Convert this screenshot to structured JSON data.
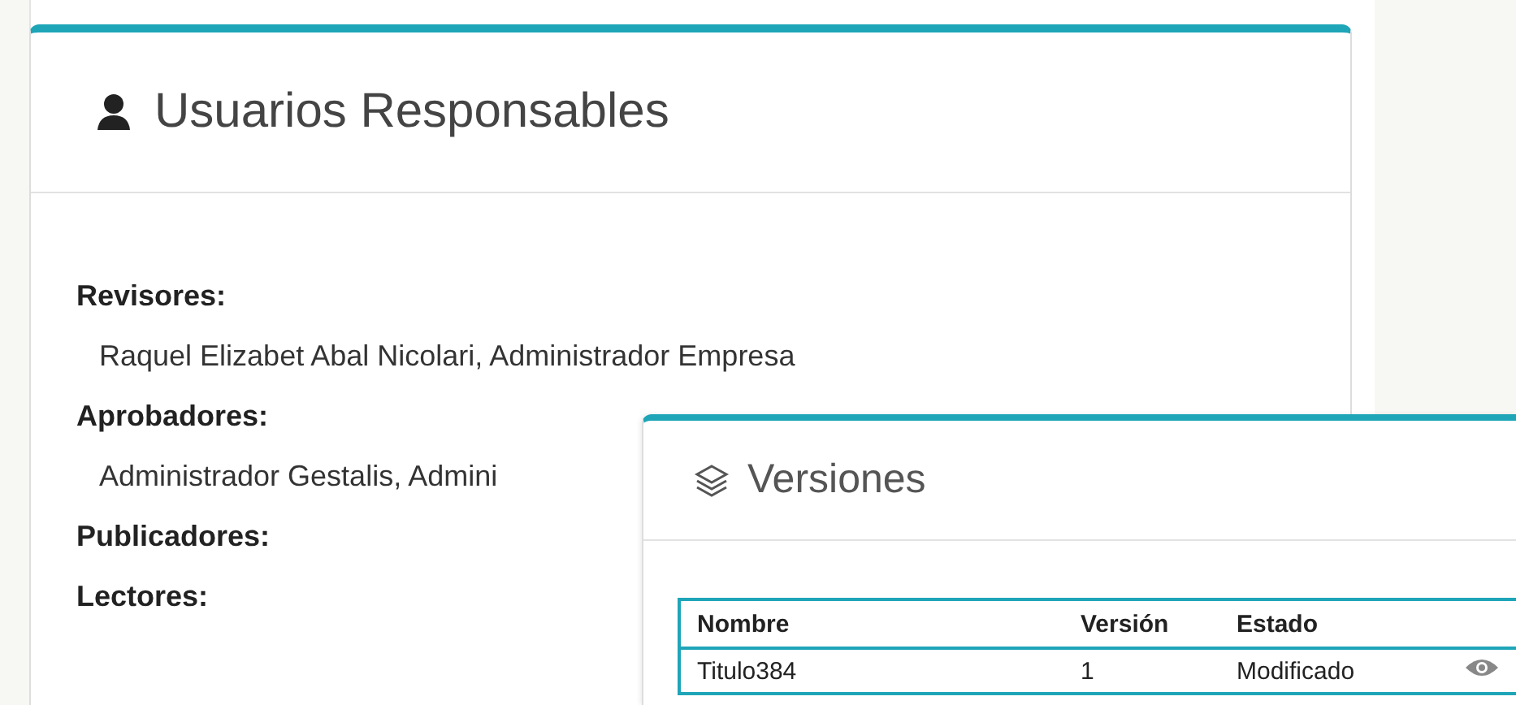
{
  "responsables": {
    "title": "Usuarios Responsables",
    "groups": [
      {
        "label": "Revisores:",
        "users": "Raquel Elizabet Abal Nicolari, Administrador Empresa"
      },
      {
        "label": "Aprobadores:",
        "users": "Administrador Gestalis, Admini"
      },
      {
        "label": "Publicadores:"
      },
      {
        "label": "Lectores:"
      }
    ]
  },
  "versiones": {
    "title": "Versiones",
    "table": {
      "columns": [
        "Nombre",
        "Versión",
        "Estado"
      ],
      "rows": [
        {
          "nombre": "Titulo384",
          "version": "1",
          "estado": "Modificado"
        }
      ]
    }
  }
}
